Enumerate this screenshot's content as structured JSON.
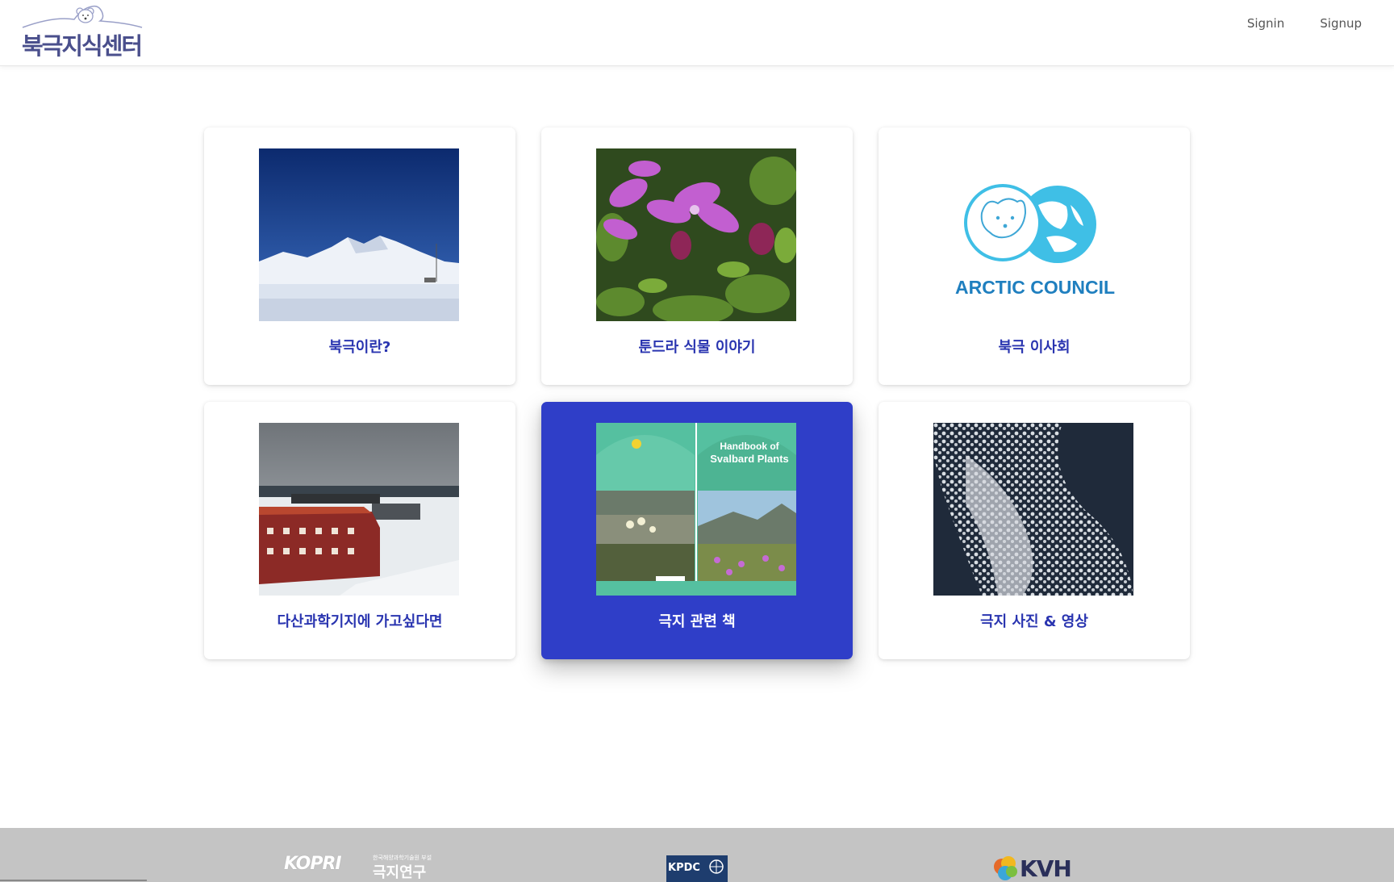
{
  "header": {
    "logo_text": "북극지식센터",
    "nav": [
      {
        "label": "Signin"
      },
      {
        "label": "Signup"
      }
    ]
  },
  "cards": [
    {
      "title": "북극이란?",
      "image": "arctic-mountain-photo",
      "active": false
    },
    {
      "title": "툰드라 식물 이야기",
      "image": "tundra-flower-photo",
      "active": false
    },
    {
      "title": "북극 이사회",
      "image": "arctic-council-logo",
      "active": false,
      "logo_text": "ARCTIC COUNCIL"
    },
    {
      "title": "다산과학기지에 가고싶다면",
      "image": "dasan-station-photo",
      "active": false
    },
    {
      "title": "극지 관련 책",
      "image": "svalbard-plants-book-cover",
      "active": true,
      "book_title_1": "Handbook of",
      "book_title_2": "Svalbard Plants"
    },
    {
      "title": "극지 사진 & 영상",
      "image": "sea-ice-aerial-photo",
      "active": false
    }
  ],
  "footer": {
    "kopri_logo": "KOPRI",
    "kopri_sub": "한국해양과학기술원 부설",
    "kopri_name": "극지연구소",
    "kpdc_logo": "KPDC",
    "kvh_logo": "KVH"
  },
  "colors": {
    "accent": "#2f3ec8",
    "card_title": "#2a35b0",
    "logo": "#4a4f8c",
    "footer_bg": "#c4c4c4"
  }
}
